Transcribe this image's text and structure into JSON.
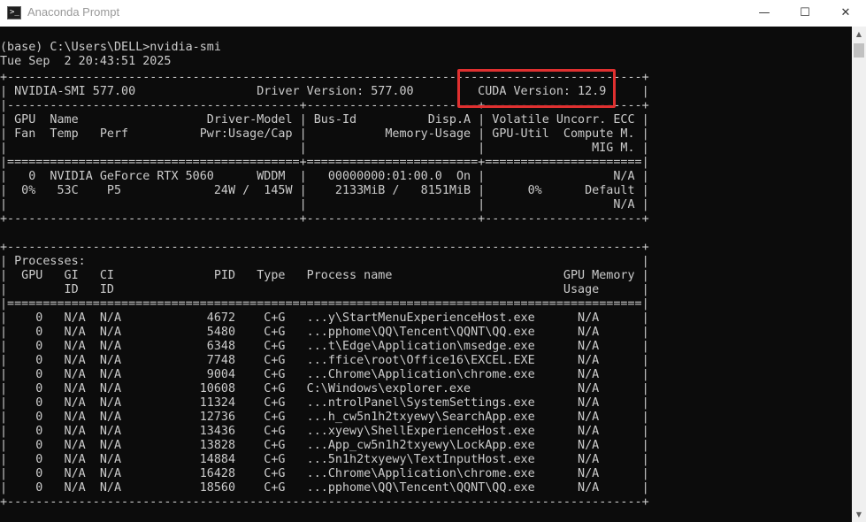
{
  "window": {
    "title": "Anaconda Prompt",
    "controls": {
      "minimize": "—",
      "maximize": "☐",
      "close": "✕"
    }
  },
  "console": {
    "lines": [
      "(base) C:\\Users\\DELL>nvidia-smi",
      "Tue Sep  2 20:43:51 2025",
      "+-----------------------------------------------------------------------------------------+",
      "| NVIDIA-SMI 577.00                 Driver Version: 577.00         CUDA Version: 12.9     |",
      "|-----------------------------------------+------------------------+----------------------+",
      "| GPU  Name                  Driver-Model | Bus-Id          Disp.A | Volatile Uncorr. ECC |",
      "| Fan  Temp   Perf          Pwr:Usage/Cap |           Memory-Usage | GPU-Util  Compute M. |",
      "|                                         |                        |               MIG M. |",
      "|=========================================+========================+======================|",
      "|   0  NVIDIA GeForce RTX 5060      WDDM  |   00000000:01:00.0  On |                  N/A |",
      "|  0%   53C    P5             24W /  145W |    2133MiB /   8151MiB |      0%      Default |",
      "|                                         |                        |                  N/A |",
      "+-----------------------------------------+------------------------+----------------------+",
      "",
      "+-----------------------------------------------------------------------------------------+",
      "| Processes:                                                                              |",
      "|  GPU   GI   CI              PID   Type   Process name                        GPU Memory |",
      "|        ID   ID                                                               Usage      |",
      "|=========================================================================================|",
      "|    0   N/A  N/A            4672    C+G   ...y\\StartMenuExperienceHost.exe      N/A      |",
      "|    0   N/A  N/A            5480    C+G   ...pphome\\QQ\\Tencent\\QQNT\\QQ.exe      N/A      |",
      "|    0   N/A  N/A            6348    C+G   ...t\\Edge\\Application\\msedge.exe      N/A      |",
      "|    0   N/A  N/A            7748    C+G   ...ffice\\root\\Office16\\EXCEL.EXE      N/A      |",
      "|    0   N/A  N/A            9004    C+G   ...Chrome\\Application\\chrome.exe      N/A      |",
      "|    0   N/A  N/A           10608    C+G   C:\\Windows\\explorer.exe               N/A      |",
      "|    0   N/A  N/A           11324    C+G   ...ntrolPanel\\SystemSettings.exe      N/A      |",
      "|    0   N/A  N/A           12736    C+G   ...h_cw5n1h2txyewy\\SearchApp.exe      N/A      |",
      "|    0   N/A  N/A           13436    C+G   ...xyewy\\ShellExperienceHost.exe      N/A      |",
      "|    0   N/A  N/A           13828    C+G   ...App_cw5n1h2txyewy\\LockApp.exe      N/A      |",
      "|    0   N/A  N/A           14884    C+G   ...5n1h2txyewy\\TextInputHost.exe      N/A      |",
      "|    0   N/A  N/A           16428    C+G   ...Chrome\\Application\\chrome.exe      N/A      |",
      "|    0   N/A  N/A           18560    C+G   ...pphome\\QQ\\Tencent\\QQNT\\QQ.exe      N/A      |",
      "+-----------------------------------------------------------------------------------------+"
    ]
  },
  "scrollbar": {
    "up_arrow": "▲",
    "down_arrow": "▼"
  },
  "colors": {
    "console_bg": "#0c0c0c",
    "console_text": "#cccccc",
    "highlight": "#e03030"
  }
}
